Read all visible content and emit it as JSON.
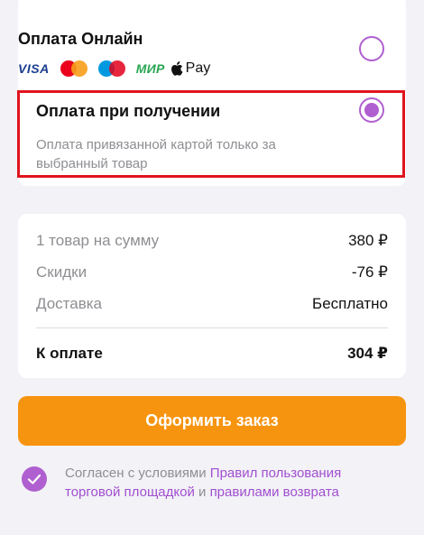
{
  "payment": {
    "online": {
      "title": "Оплата Онлайн",
      "logos": [
        "VISA",
        "mastercard-icon",
        "maestro-icon",
        "МИР",
        "Pay"
      ]
    },
    "cod": {
      "title": "Оплата при получении",
      "description": "Оплата привязанной картой только за выбранный товар",
      "selected": true
    }
  },
  "summary": {
    "rows": [
      {
        "label": "1 товар на сумму",
        "value": "380 ₽"
      },
      {
        "label": "Скидки",
        "value": "-76 ₽"
      },
      {
        "label": "Доставка",
        "value": "Бесплатно"
      }
    ],
    "total_label": "К оплате",
    "total_value": "304 ₽"
  },
  "order_button": "Оформить заказ",
  "agreement": {
    "prefix": "Согласен с условиями ",
    "link1": "Правил пользования торговой площадкой",
    "middle": " и ",
    "link2": "правилами возврата",
    "checked": true
  },
  "colors": {
    "accent_purple": "#b05fd0",
    "button_orange": "#f7940f",
    "highlight_red": "#e0141e"
  }
}
